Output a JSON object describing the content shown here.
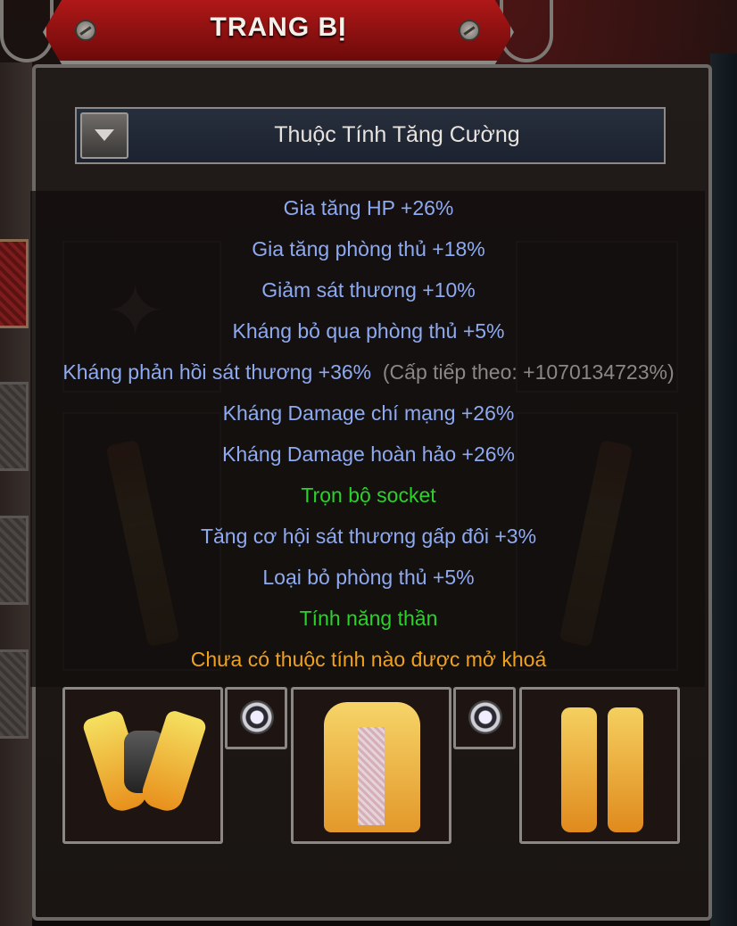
{
  "window": {
    "title": "TRANG BỊ"
  },
  "dropdown": {
    "selected": "Thuộc Tính Tăng Cường"
  },
  "attributes": [
    {
      "text": "Gia tăng HP +26%",
      "type": "stat"
    },
    {
      "text": "Gia tăng phòng thủ +18%",
      "type": "stat"
    },
    {
      "text": "Giảm sát thương +10%",
      "type": "stat"
    },
    {
      "text": "Kháng bỏ qua phòng thủ +5%",
      "type": "stat"
    },
    {
      "text": "Kháng phản hồi sát thương +36%",
      "next": "(Cấp tiếp theo: +1070134723%)",
      "type": "stat"
    },
    {
      "text": "Kháng Damage chí mạng +26%",
      "type": "stat"
    },
    {
      "text": "Kháng Damage hoàn hảo +26%",
      "type": "stat"
    },
    {
      "text": "Trọn bộ socket",
      "type": "header"
    },
    {
      "text": "Tăng cơ hội sát thương gấp đôi +3%",
      "type": "stat"
    },
    {
      "text": "Loại bỏ phòng thủ +5%",
      "type": "stat"
    },
    {
      "text": "Tính năng thần",
      "type": "header"
    },
    {
      "text": "Chưa có thuộc tính nào được mở khoá",
      "type": "notice"
    }
  ],
  "colors": {
    "stat": "#8eaaf2",
    "header": "#2bd22b",
    "notice": "#f0a21c",
    "banner": "#b01818"
  },
  "icons": [
    "dropdown-arrow-icon",
    "screw-icon",
    "gloves-icon",
    "armor-icon",
    "boots-icon",
    "socket-gem-icon",
    "wings-icon",
    "sword-icon"
  ]
}
